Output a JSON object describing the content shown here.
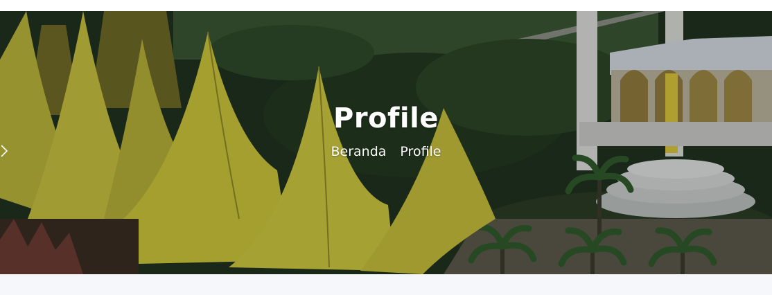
{
  "hero": {
    "title": "Profile",
    "breadcrumb": {
      "home_label": "Beranda",
      "separator_icon": "chevron-right-icon",
      "current_label": "Profile"
    }
  },
  "colors": {
    "title_text": "#ffffff",
    "page_background": "#f5f7fb",
    "roof_yellow": "#c9c23a",
    "foliage": "#2f4b2a"
  }
}
